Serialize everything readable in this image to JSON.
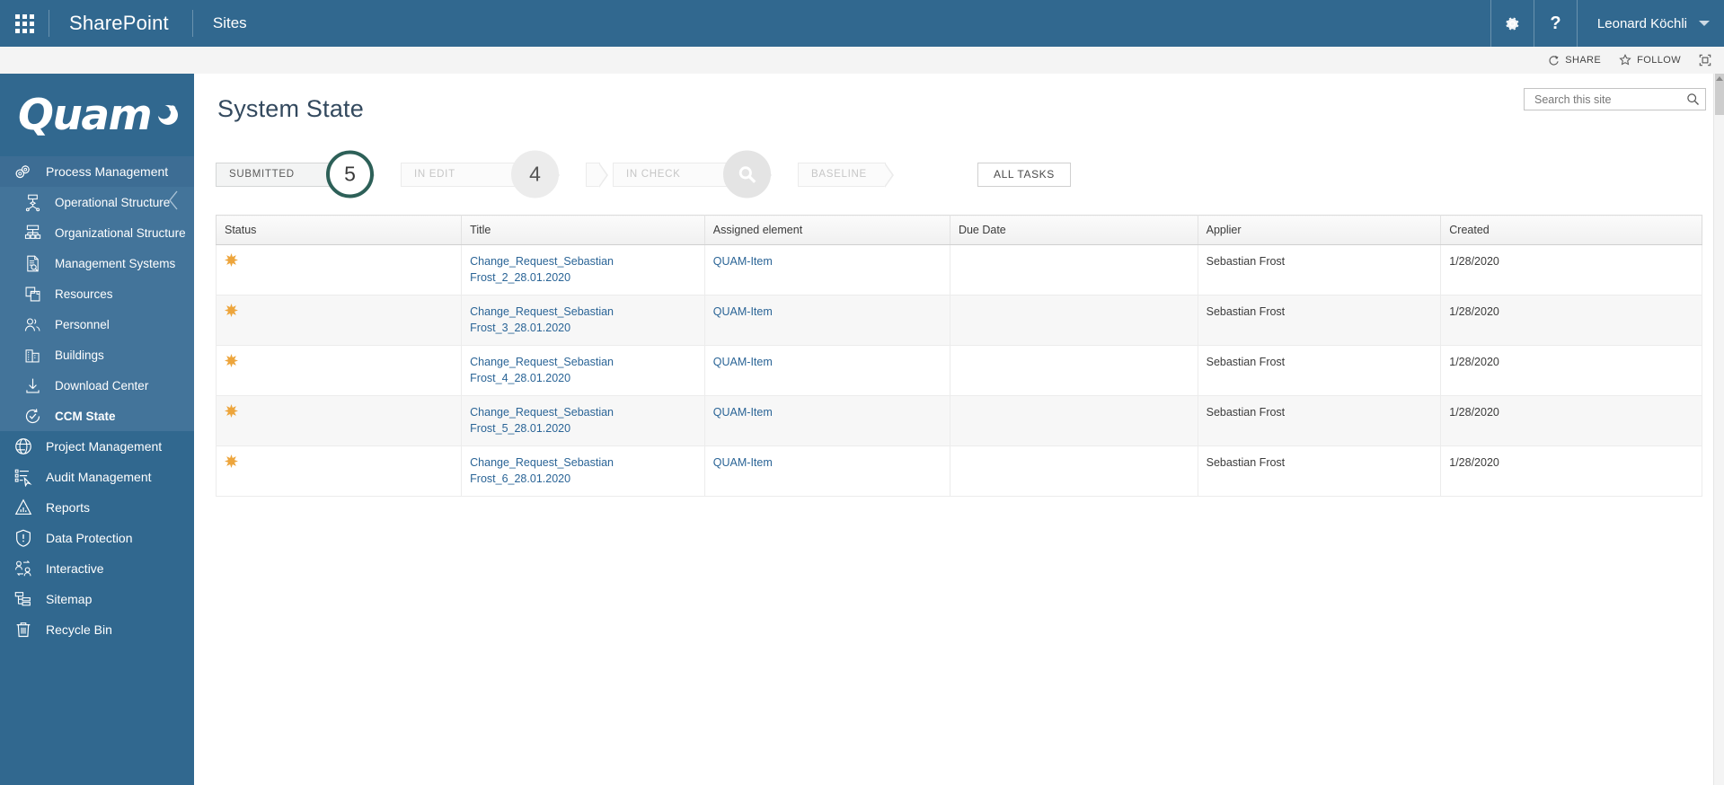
{
  "suite_bar": {
    "waffle_icon": "app-launcher-waffle-icon",
    "brand": "SharePoint",
    "sites_label": "Sites",
    "settings_icon": "gear-icon",
    "help_icon": "question-mark-icon",
    "user_name": "Leonard Köchli",
    "user_caret_icon": "chevron-down-icon"
  },
  "action_strip": {
    "share_label": "SHARE",
    "share_icon": "share-icon",
    "follow_label": "FOLLOW",
    "follow_icon": "star-icon",
    "focus_icon": "focus-on-content-icon"
  },
  "sidebar": {
    "logo_text": "Quam",
    "logo_mark": "quam-dot-icon",
    "collapse_icon": "chevron-left-icon",
    "groups": [
      {
        "header": {
          "label": "Process Management",
          "icon": "gears-icon",
          "active": true
        },
        "items": [
          {
            "label": "Operational Structure",
            "icon": "operational-structure-icon"
          },
          {
            "label": "Organizational Structure",
            "icon": "organizational-structure-icon"
          },
          {
            "label": "Management Systems",
            "icon": "management-systems-icon"
          },
          {
            "label": "Resources",
            "icon": "resources-icon"
          },
          {
            "label": "Personnel",
            "icon": "personnel-icon"
          },
          {
            "label": "Buildings",
            "icon": "buildings-icon"
          },
          {
            "label": "Download Center",
            "icon": "download-icon"
          },
          {
            "label": "CCM State",
            "icon": "ccm-state-icon",
            "active": true
          }
        ]
      }
    ],
    "bottom_items": [
      {
        "label": "Project Management",
        "icon": "globe-icon"
      },
      {
        "label": "Audit Management",
        "icon": "audit-checklist-icon"
      },
      {
        "label": "Reports",
        "icon": "reports-chart-icon"
      },
      {
        "label": "Data Protection",
        "icon": "shield-icon"
      },
      {
        "label": "Interactive",
        "icon": "interactive-users-icon"
      },
      {
        "label": "Sitemap",
        "icon": "sitemap-icon"
      },
      {
        "label": "Recycle Bin",
        "icon": "trash-icon"
      }
    ]
  },
  "main": {
    "page_title": "System State",
    "search": {
      "placeholder": "Search this site",
      "value": "",
      "icon": "search-icon"
    },
    "workflow": {
      "stages": [
        {
          "label": "SUBMITTED",
          "count": "5",
          "state": "active"
        },
        {
          "label": "IN EDIT",
          "count": "4",
          "state": "inactive"
        },
        {
          "label": "IN CHECK",
          "count": "",
          "state": "inactive",
          "badge_icon": "search-icon"
        },
        {
          "label": "BASELINE",
          "count": "",
          "state": "inactive"
        }
      ],
      "all_tasks_label": "ALL TASKS"
    },
    "table": {
      "columns": [
        "Status",
        "Title",
        "Assigned element",
        "Due Date",
        "Applier",
        "Created"
      ],
      "rows": [
        {
          "status_icon": "new-item-star-icon",
          "title": "Change_Request_Sebastian Frost_2_28.01.2020",
          "assigned_element": "QUAM-Item",
          "due_date": "",
          "applier": "Sebastian Frost",
          "created": "1/28/2020"
        },
        {
          "status_icon": "new-item-star-icon",
          "title": "Change_Request_Sebastian Frost_3_28.01.2020",
          "assigned_element": "QUAM-Item",
          "due_date": "",
          "applier": "Sebastian Frost",
          "created": "1/28/2020"
        },
        {
          "status_icon": "new-item-star-icon",
          "title": "Change_Request_Sebastian Frost_4_28.01.2020",
          "assigned_element": "QUAM-Item",
          "due_date": "",
          "applier": "Sebastian Frost",
          "created": "1/28/2020"
        },
        {
          "status_icon": "new-item-star-icon",
          "title": "Change_Request_Sebastian Frost_5_28.01.2020",
          "assigned_element": "QUAM-Item",
          "due_date": "",
          "applier": "Sebastian Frost",
          "created": "1/28/2020"
        },
        {
          "status_icon": "new-item-star-icon",
          "title": "Change_Request_Sebastian Frost_6_28.01.2020",
          "assigned_element": "QUAM-Item",
          "due_date": "",
          "applier": "Sebastian Frost",
          "created": "1/28/2020"
        }
      ]
    }
  },
  "colors": {
    "suite_bar": "#31688f",
    "sidebar": "#31688f",
    "sidebar_sub": "#43749a",
    "active_stage_ring": "#2d6058",
    "link": "#2a6496",
    "status_star": "#eda53c"
  }
}
